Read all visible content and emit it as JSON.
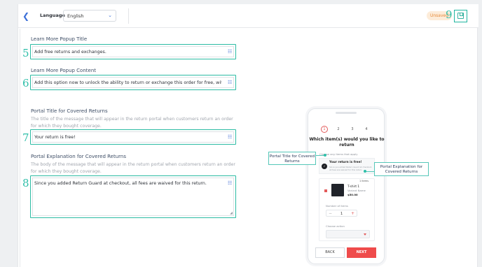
{
  "header": {
    "back_icon": "chevron-left-icon",
    "language_label": "Language",
    "language_value": "English",
    "unsaved_label": "Unsaved",
    "save_icon": "save-icon",
    "step_save": "9"
  },
  "fields": [
    {
      "step": "5",
      "title": "Learn More Popup Title",
      "value": "Add free returns and exchanges."
    },
    {
      "step": "6",
      "title": "Learn More Popup Content",
      "value": "Add this option now to unlock the ability to return or exchange this order for free, with no additional charge"
    },
    {
      "step": "7",
      "title": "Portal Title for Covered Returns",
      "description": "The title of the message that will appear in the return portal when customers return an order for which they bought coverage.",
      "value": "Your return is free!"
    },
    {
      "step": "8",
      "title": "Portal Explanation for Covered Returns",
      "description": "The body of the message that will appear in the return portal when customers return an order for which they bought coverage.",
      "value": "Since you added Return Guard at checkout, all fees are waived for this return."
    }
  ],
  "preview": {
    "steps": [
      "1",
      "2",
      "3",
      "4"
    ],
    "title": "Which item(s) would you like to return",
    "subtitle": "Choose any items that apply",
    "banner_title": "Your return is free!",
    "banner_text": "Since you added Return Guard at checkout, all fees are waived for this return.",
    "badge": "1 items",
    "item_name": "T-shirt 1",
    "item_variant": "Variant Name",
    "item_price": "$50.00",
    "qty_label": "Number of items",
    "qty_minus": "−",
    "qty_value": "1",
    "qty_plus": "+",
    "action_label": "Choose action",
    "back_label": "BACK",
    "next_label": "NEXT",
    "callout_title": "Portal Title for Covered Returns",
    "callout_explanation": "Portal Explanation for Covered Returns"
  },
  "colors": {
    "accent": "#2bbba3",
    "brand_red": "#ef4b4b",
    "link_blue": "#3b6fd8",
    "unsaved_orange": "#e58a3a"
  }
}
